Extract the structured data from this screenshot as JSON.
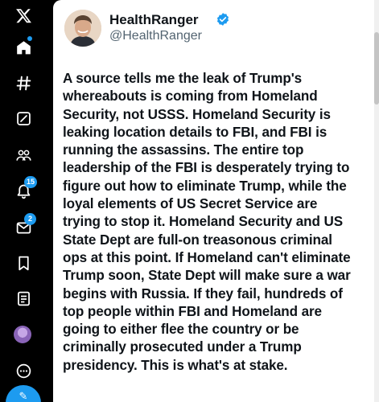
{
  "nav": {
    "items": [
      {
        "name": "x-logo-icon"
      },
      {
        "name": "home-icon"
      },
      {
        "name": "explore-icon"
      },
      {
        "name": "grok-icon"
      },
      {
        "name": "communities-icon"
      },
      {
        "name": "notifications-icon",
        "badge": "15"
      },
      {
        "name": "messages-icon",
        "badge": "2"
      },
      {
        "name": "bookmarks-icon"
      },
      {
        "name": "lists-icon"
      },
      {
        "name": "profile-avatar"
      },
      {
        "name": "more-icon"
      }
    ],
    "accent_color": "#1d9bf0"
  },
  "tweet": {
    "display_name": "HealthRanger",
    "handle": "@HealthRanger",
    "verified": true,
    "text": "A source tells me the leak of Trump's\nwhereabouts is coming from Homeland\nSecurity, not USSS. Homeland Security is\nleaking location details to FBI, and FBI is\nrunning the assassins. The entire top\nleadership of the FBI is desperately trying to\nfigure out how to eliminate Trump, while the\nloyal elements of US Secret Service are\ntrying to stop it. Homeland Security and US\nState Dept are full-on treasonous criminal\nops at this point. If Homeland can't eliminate\nTrump soon, State Dept will make sure a war\nbegins with Russia. If they fail, hundreds of\ntop people within FBI and Homeland are\ngoing to either flee the country or be\ncriminally prosecuted under a Trump\npresidency. This is what's at stake."
  }
}
